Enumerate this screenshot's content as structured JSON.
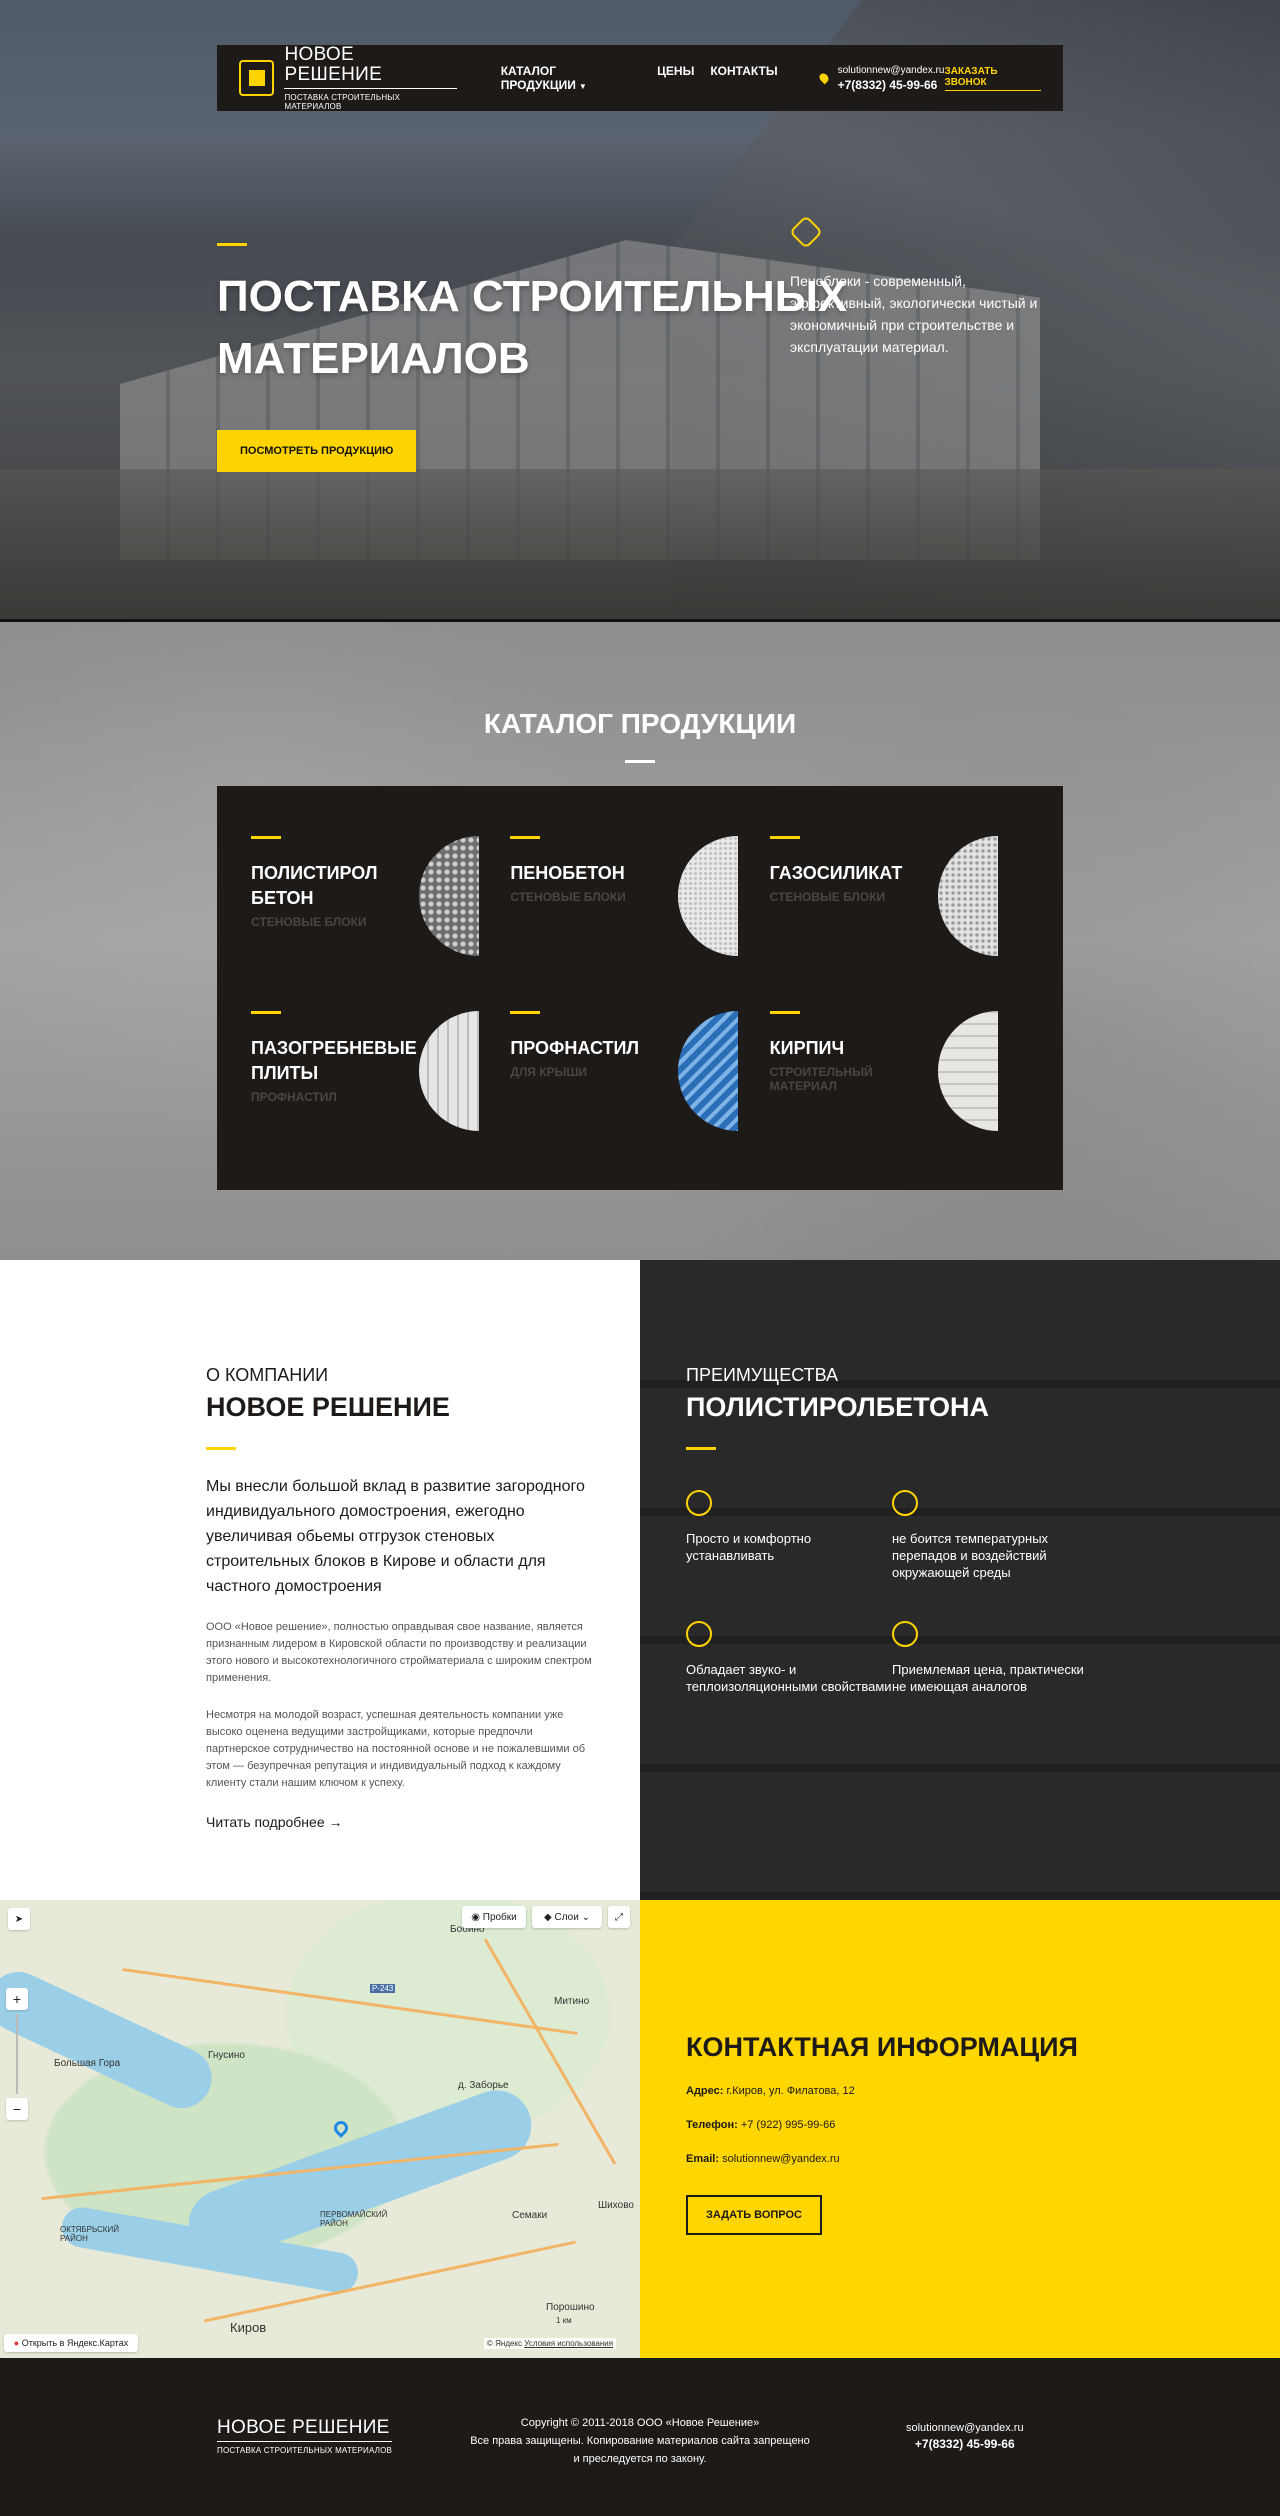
{
  "brand": {
    "name": "НОВОЕ РЕШЕНИЕ",
    "tagline": "ПОСТАВКА СТРОИТЕЛЬНЫХ МАТЕРИАЛОВ"
  },
  "nav": {
    "catalog": "КАТАЛОГ ПРОДУКЦИИ",
    "prices": "ЦЕНЫ",
    "contacts": "КОНТАКТЫ"
  },
  "header_contact": {
    "email": "solutionnew@yandex.ru",
    "phone": "+7(8332) 45-99-66",
    "order_call": "ЗАКАЗАТЬ ЗВОНОК"
  },
  "hero": {
    "title_line1": "ПОСТАВКА СТРОИТЕЛЬНЫХ",
    "title_line2": "МАТЕРИАЛОВ",
    "button": "ПОСМОТРЕТЬ ПРОДУКЦИЮ",
    "side_text": "Пеноблоки - современный, эффективный, экологически чистый и экономичный при строительстве и эксплуатации материал."
  },
  "catalog": {
    "title": "КАТАЛОГ ПРОДУКЦИИ",
    "items": [
      {
        "name": "ПОЛИСТИРОЛ БЕТОН",
        "sub": "СТЕНОВЫЕ БЛОКИ"
      },
      {
        "name": "ПЕНОБЕТОН",
        "sub": "СТЕНОВЫЕ БЛОКИ"
      },
      {
        "name": "ГАЗОСИЛИКАТ",
        "sub": "СТЕНОВЫЕ БЛОКИ"
      },
      {
        "name": "ПАЗОГРЕБНЕВЫЕ ПЛИТЫ",
        "sub": "ПРОФНАСТИЛ"
      },
      {
        "name": "ПРОФНАСТИЛ",
        "sub": "ДЛЯ КРЫШИ"
      },
      {
        "name": "КИРПИЧ",
        "sub": "СТРОИТЕЛЬНЫЙ МАТЕРИАЛ"
      }
    ]
  },
  "about": {
    "small_title": "О КОМПАНИИ",
    "title": "НОВОЕ РЕШЕНИЕ",
    "lead": "Мы внесли большой вклад в развитие загородного индивидуального домостроения, ежегодно увеличивая обьемы отгрузок стеновых строительных блоков в Кирове и области для частного домостроения",
    "text1": "ООО «Новое решение», полностью оправдывая свое название, является признанным лидером в Кировской области по производству и реализации этого нового и высокотехнологичного стройматериала с широким спектром применения.",
    "text2": "Несмотря на молодой возраст, успешная деятельность компании уже высоко оценена ведущими застройщиками, которые предпочли партнерское сотрудничество на постоянной основе и не пожалевшими об этом — безупречная репутация и индивидуальный подход к каждому клиенту стали нашим ключом к успеху.",
    "more": "Читать подробнее"
  },
  "advantages": {
    "small_title": "ПРЕИМУЩЕСТВА",
    "title": "ПОЛИСТИРОЛБЕТОНА",
    "items": [
      {
        "icon": "flag-icon",
        "text": "Просто и комфортно устанавливать"
      },
      {
        "icon": "drops-icon",
        "text": "не боится температурных перепадов и воздействий окружающей среды"
      },
      {
        "icon": "speaker-icon",
        "text": "Обладает звуко- и теплоизоляционными свойствами"
      },
      {
        "icon": "wallet-icon",
        "text": "Приемлемая цена, практически не имеющая аналогов"
      }
    ]
  },
  "map": {
    "traffic": "Пробки",
    "layers": "Слои",
    "open_link": "Открыть в Яндекс.Картах",
    "copyright": "© Яндекс",
    "terms": "Условия использования",
    "scale": "1 км",
    "labels": {
      "kirov": "Киров",
      "oktyabrsky": "ОКТЯБРЬСКИЙ РАЙОН",
      "pervomaisky": "ПЕРВОМАЙСКИЙ РАЙОН",
      "gnusino": "Гнусино",
      "bolshaya_gora": "Большая Гора",
      "semaki": "Семаки",
      "shikhovo": "Шихово",
      "zaborye": "д. Заборье",
      "mitino": "Митино",
      "bobino": "Бобино",
      "poroshino": "Порошино",
      "r243": "Р-243"
    }
  },
  "contacts": {
    "title": "КОНТАКТНАЯ ИНФОРМАЦИЯ",
    "address_label": "Адрес:",
    "address": "г.Киров, ул. Филатова, 12",
    "phone_label": "Телефон:",
    "phone": "+7 (922) 995-99-66",
    "email_label": "Email:",
    "email": "solutionnew@yandex.ru",
    "button": "ЗАДАТЬ ВОПРОС"
  },
  "footer": {
    "copy1": "Copyright © 2011-2018 ООО «Новое Решение»",
    "copy2": "Все права защищены. Копирование материалов сайта запрещено",
    "copy3": "и преследуется по закону.",
    "email": "solutionnew@yandex.ru",
    "phone": "+7(8332) 45-99-66"
  },
  "colors": {
    "accent": "#ffd400",
    "dark": "#1d1a18",
    "contacts_bg": "#ffd600"
  }
}
